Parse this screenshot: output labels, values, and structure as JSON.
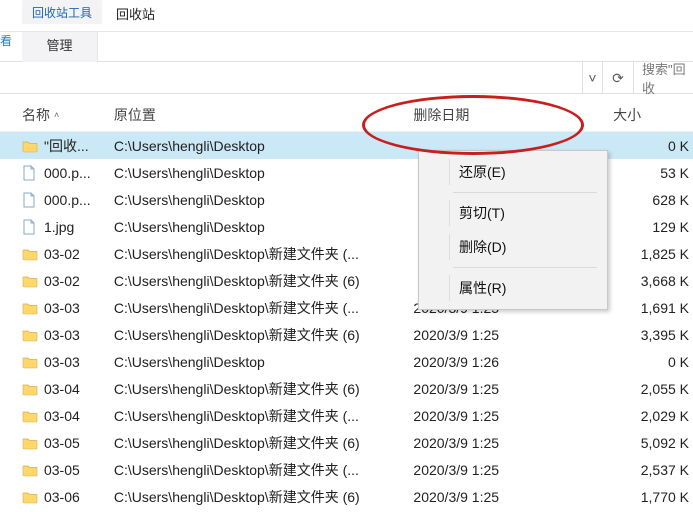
{
  "ribbon": {
    "smalltab": "回收站工具",
    "title": "回收站",
    "manage": "管理",
    "left_edge": "看"
  },
  "toolbar": {
    "dropdown_glyph": "˅",
    "refresh_glyph": "⟳",
    "search_placeholder": "搜索\"回收"
  },
  "columns": {
    "name": "名称",
    "location": "原位置",
    "deleted": "删除日期",
    "size": "大小"
  },
  "context_menu": {
    "restore": "还原(E)",
    "cut": "剪切(T)",
    "delete": "删除(D)",
    "properties": "属性(R)"
  },
  "rows": [
    {
      "icon": "folder",
      "name": "\"回收...",
      "loc": "C:\\Users\\hengli\\Desktop",
      "date": "",
      "size": "0 K",
      "selected": true
    },
    {
      "icon": "page",
      "name": "000.p...",
      "loc": "C:\\Users\\hengli\\Desktop",
      "date": "",
      "size": "53 K"
    },
    {
      "icon": "page",
      "name": "000.p...",
      "loc": "C:\\Users\\hengli\\Desktop",
      "date": "",
      "size": "628 K"
    },
    {
      "icon": "page",
      "name": "1.jpg",
      "loc": "C:\\Users\\hengli\\Desktop",
      "date": "",
      "size": "129 K"
    },
    {
      "icon": "folder",
      "name": "03-02",
      "loc": "C:\\Users\\hengli\\Desktop\\新建文件夹 (...",
      "date": "",
      "size": "1,825 K"
    },
    {
      "icon": "folder",
      "name": "03-02",
      "loc": "C:\\Users\\hengli\\Desktop\\新建文件夹 (6)",
      "date": "",
      "size": "3,668 K"
    },
    {
      "icon": "folder",
      "name": "03-03",
      "loc": "C:\\Users\\hengli\\Desktop\\新建文件夹 (...",
      "date": "2020/3/9 1:25",
      "size": "1,691 K"
    },
    {
      "icon": "folder",
      "name": "03-03",
      "loc": "C:\\Users\\hengli\\Desktop\\新建文件夹 (6)",
      "date": "2020/3/9 1:25",
      "size": "3,395 K"
    },
    {
      "icon": "folder",
      "name": "03-03",
      "loc": "C:\\Users\\hengli\\Desktop",
      "date": "2020/3/9 1:26",
      "size": "0 K"
    },
    {
      "icon": "folder",
      "name": "03-04",
      "loc": "C:\\Users\\hengli\\Desktop\\新建文件夹 (6)",
      "date": "2020/3/9 1:25",
      "size": "2,055 K"
    },
    {
      "icon": "folder",
      "name": "03-04",
      "loc": "C:\\Users\\hengli\\Desktop\\新建文件夹 (...",
      "date": "2020/3/9 1:25",
      "size": "2,029 K"
    },
    {
      "icon": "folder",
      "name": "03-05",
      "loc": "C:\\Users\\hengli\\Desktop\\新建文件夹 (6)",
      "date": "2020/3/9 1:25",
      "size": "5,092 K"
    },
    {
      "icon": "folder",
      "name": "03-05",
      "loc": "C:\\Users\\hengli\\Desktop\\新建文件夹 (...",
      "date": "2020/3/9 1:25",
      "size": "2,537 K"
    },
    {
      "icon": "folder",
      "name": "03-06",
      "loc": "C:\\Users\\hengli\\Desktop\\新建文件夹 (6)",
      "date": "2020/3/9 1:25",
      "size": "1,770 K"
    }
  ]
}
